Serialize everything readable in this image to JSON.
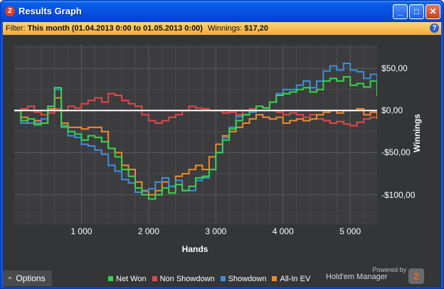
{
  "window": {
    "title": "Results Graph",
    "app_icon_text": "2",
    "controls": {
      "minimize": "_",
      "maximize": "□",
      "close": "✕"
    }
  },
  "filter": {
    "label": "Filter:",
    "value": "This month (01.04.2013 0:00 to 01.05.2013 0:00)",
    "winnings_label": "Winnings:",
    "winnings_value": "$17,20",
    "help_text": "?"
  },
  "footer": {
    "options_label": "Options",
    "options_arrow": "^",
    "powered_by": "Powered by",
    "brand": "Hold'em Manager",
    "brand_badge": "2"
  },
  "colors": {
    "net_won": "#34d64a",
    "non_showdown": "#e0484a",
    "showdown": "#3c8fe0",
    "all_in_ev": "#f08a2a",
    "zero_line": "#ffffff",
    "background": "#343537"
  },
  "chart_data": {
    "type": "line",
    "xlabel": "Hands",
    "ylabel": "Winnings",
    "xlim": [
      0,
      5400
    ],
    "ylim": [
      -135,
      78
    ],
    "x_ticks": [
      1000,
      2000,
      3000,
      4000,
      5000
    ],
    "x_tick_labels": [
      "1 000",
      "2 000",
      "3 000",
      "4 000",
      "5 000"
    ],
    "y_ticks": [
      50,
      0,
      -50,
      -100
    ],
    "y_tick_labels": [
      "$50,00",
      "$0,00",
      "-$50,00",
      "-$100,00"
    ],
    "grid": true,
    "legend_position": "bottom",
    "x": [
      0,
      100,
      200,
      300,
      400,
      500,
      600,
      700,
      800,
      900,
      1000,
      1100,
      1200,
      1300,
      1400,
      1500,
      1600,
      1700,
      1800,
      1900,
      2000,
      2100,
      2200,
      2300,
      2400,
      2500,
      2600,
      2700,
      2800,
      2900,
      3000,
      3100,
      3200,
      3300,
      3400,
      3500,
      3600,
      3700,
      3800,
      3900,
      4000,
      4100,
      4200,
      4300,
      4400,
      4500,
      4600,
      4700,
      4800,
      4900,
      5000,
      5100,
      5200,
      5300,
      5400
    ],
    "series": [
      {
        "name": "Net Won",
        "values": [
          0,
          -12,
          -10,
          -17,
          -15,
          5,
          27,
          -18,
          -25,
          -28,
          -35,
          -30,
          -32,
          -37,
          -45,
          -55,
          -70,
          -78,
          -92,
          -100,
          -105,
          -100,
          -92,
          -98,
          -88,
          -95,
          -90,
          -80,
          -78,
          -70,
          -50,
          -35,
          -22,
          -12,
          -5,
          0,
          5,
          3,
          10,
          18,
          20,
          22,
          25,
          27,
          22,
          25,
          35,
          38,
          35,
          40,
          30,
          32,
          28,
          35,
          17
        ]
      },
      {
        "name": "Non Showdown",
        "values": [
          0,
          2,
          5,
          -2,
          -5,
          -3,
          2,
          0,
          5,
          3,
          8,
          12,
          15,
          10,
          20,
          18,
          12,
          8,
          5,
          -5,
          -12,
          -15,
          -12,
          -8,
          -5,
          0,
          5,
          3,
          2,
          0,
          0,
          -3,
          -2,
          -5,
          0,
          2,
          5,
          3,
          0,
          -2,
          -5,
          -3,
          -5,
          -8,
          -5,
          -10,
          -12,
          -15,
          -13,
          -16,
          -18,
          -14,
          -10,
          -8,
          -8
        ]
      },
      {
        "name": "Showdown",
        "values": [
          0,
          -15,
          -15,
          -15,
          -10,
          5,
          25,
          -20,
          -30,
          -32,
          -40,
          -42,
          -47,
          -52,
          -65,
          -72,
          -82,
          -86,
          -97,
          -96,
          -93,
          -85,
          -80,
          -90,
          -83,
          -95,
          -95,
          -83,
          -80,
          -70,
          -50,
          -32,
          -20,
          -7,
          -5,
          -2,
          0,
          0,
          10,
          20,
          25,
          25,
          30,
          35,
          27,
          35,
          47,
          53,
          48,
          56,
          48,
          46,
          38,
          43,
          25
        ]
      },
      {
        "name": "All-In EV",
        "values": [
          0,
          -8,
          -15,
          -12,
          -15,
          2,
          15,
          -15,
          -20,
          -20,
          -22,
          -20,
          -20,
          -25,
          -45,
          -50,
          -65,
          -70,
          -85,
          -95,
          -100,
          -95,
          -85,
          -90,
          -78,
          -75,
          -70,
          -65,
          -70,
          -55,
          -40,
          -30,
          -25,
          -20,
          -15,
          -10,
          -5,
          -8,
          -10,
          -8,
          -15,
          -12,
          -10,
          -12,
          -10,
          -5,
          -2,
          0,
          -3,
          0,
          0,
          2,
          -5,
          -2,
          -10
        ]
      }
    ]
  }
}
